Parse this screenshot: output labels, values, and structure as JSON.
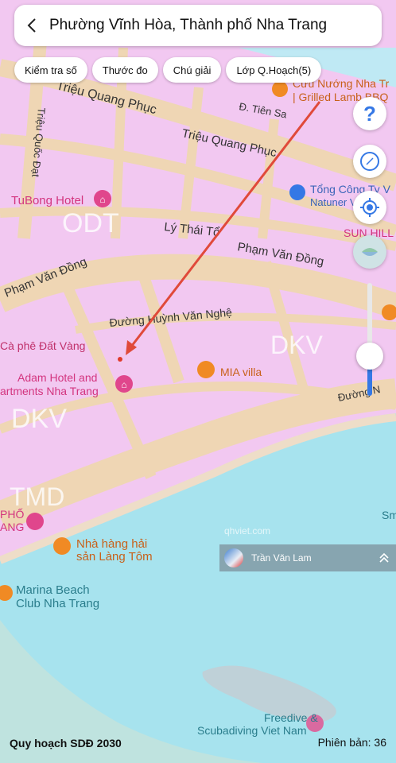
{
  "header": {
    "title": "Phường Vĩnh Hòa, Thành phố Nha Trang"
  },
  "chips": [
    "Kiểm tra số",
    "Thước đo",
    "Chú giải",
    "Lớp Q.Hoạch(5)"
  ],
  "controls": {
    "help": "?",
    "zoom_level": 0.35
  },
  "user": {
    "name": "Trần Văn Lam"
  },
  "watermark": "qhviet.com",
  "footer": {
    "plan": "Quy hoạch SDĐ 2030",
    "version": "Phiên bản: 36"
  },
  "zones": {
    "odt": "ODT",
    "dkv_right": "DKV",
    "dkv_left": "DKV",
    "tmd": "TMD"
  },
  "streets": {
    "trieu_quang_phuc_1": "Triệu Quang Phục",
    "trieu_quang_phuc_2": "Triệu Quang Phục",
    "tien_sa": "Đ. Tiên Sa",
    "trieu_quoc_dat": "Triệu Quốc Đạt",
    "ly_thai_to": "Lý Thái Tổ",
    "pham_van_dong_1": "Phạm Văn Đồng",
    "pham_van_dong_2": "Phạm Văn Đồng",
    "huynh_van_nghe": "Đường Huỳnh Văn Nghệ",
    "duong_n": "Đường N"
  },
  "pois": {
    "tubong": "TuBong Hotel",
    "cafe": "Cà phê Đất Vàng",
    "adam_1": "Adam Hotel and",
    "adam_2": "artments Nha Trang",
    "mia": "MIA villa",
    "grill_1": "Cửu Nướng Nha Tr",
    "grill_2": "| Grilled Lamb BBQ",
    "tong_1": "Tổng Công Ty V",
    "tong_2": "Natuner Vietnan",
    "sun": "SUN HILL",
    "pho_1": "PHỐ",
    "pho_2": "ANG",
    "nha_hang_1": "Nhà hàng hải",
    "nha_hang_2": "sản Làng Tôm",
    "marina_1": "Marina Beach",
    "marina_2": "Club Nha Trang",
    "freedive_1": "Freedive &",
    "freedive_2": "Scubadiving Viet Nam",
    "sm": "Sm"
  },
  "colors": {
    "land": "#f2c8f1",
    "water": "#a7e3ee",
    "road": "#efd6b4",
    "arrow": "#e04a3a",
    "primary": "#3578e5"
  }
}
